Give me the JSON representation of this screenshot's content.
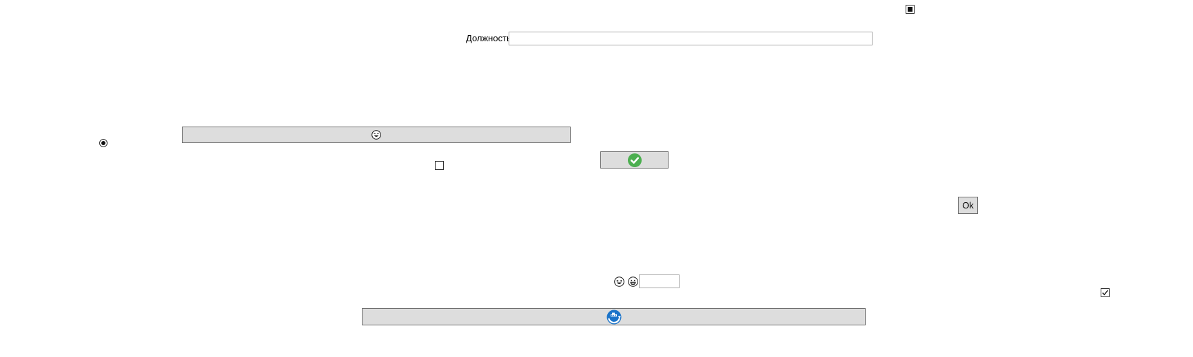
{
  "form": {
    "position_label": "Должность",
    "position_value": "",
    "small_input_value": "",
    "ok_button_label": "Ok"
  },
  "icons": {
    "top_right_checkbox": "indeterminate-checkbox-icon",
    "wide_button_icon": "smiley-face-icon",
    "confirm_button_icon": "green-checkmark-icon",
    "bottom_button_icon": "blue-refresh-ship-icon",
    "emoji_pair": [
      "laughing-face-icon",
      "grinning-face-icon"
    ]
  },
  "states": {
    "radio_selected": true,
    "middle_checkbox_checked": false,
    "bottom_right_checkbox_checked": true,
    "top_right_checkbox_state": "indeterminate"
  },
  "colors": {
    "button_bg": "#dddddd",
    "button_border": "#6e6e6e",
    "input_border": "#a9a9a9",
    "check_green": "#4caf50",
    "icon_blue": "#1a73c9"
  }
}
